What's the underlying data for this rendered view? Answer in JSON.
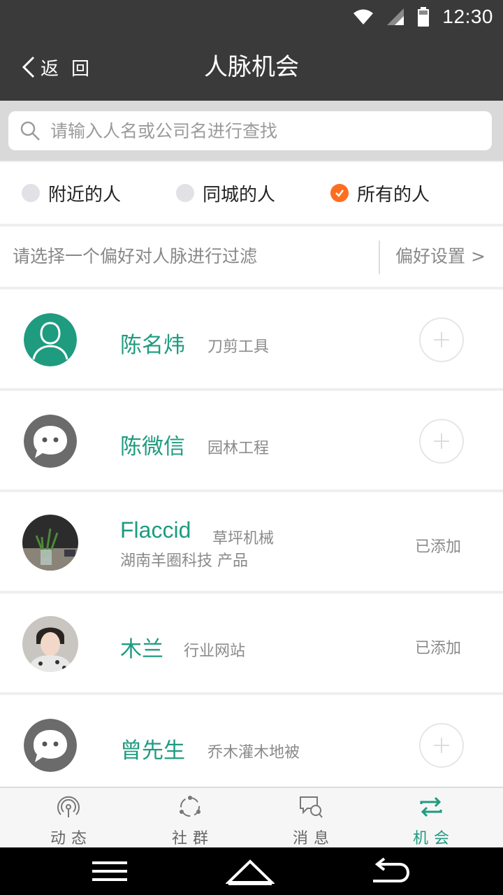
{
  "status_bar": {
    "time": "12:30"
  },
  "header": {
    "back_label": "返回",
    "title": "人脉机会"
  },
  "search": {
    "placeholder": "请输入人名或公司名进行查找"
  },
  "filters": [
    {
      "label": "附近的人",
      "checked": false
    },
    {
      "label": "同城的人",
      "checked": false
    },
    {
      "label": "所有的人",
      "checked": true
    }
  ],
  "preference": {
    "hint": "请选择一个偏好对人脉进行过滤",
    "settings_label": "偏好设置 >"
  },
  "contacts": [
    {
      "name": "陈名炜",
      "industry": "刀剪工具",
      "company": "",
      "status": "add",
      "avatar": "person-silhouette"
    },
    {
      "name": "陈微信",
      "industry": "园林工程",
      "company": "",
      "status": "add",
      "avatar": "chat-bubble"
    },
    {
      "name": "Flaccid",
      "industry": "草坪机械",
      "company": "湖南羊圈科技 产品",
      "status": "已添加",
      "avatar": "photo-plant"
    },
    {
      "name": "木兰",
      "industry": "行业网站",
      "company": "",
      "status": "已添加",
      "avatar": "photo-person"
    },
    {
      "name": "曾先生",
      "industry": "乔木灌木地被",
      "company": "",
      "status": "add",
      "avatar": "chat-bubble"
    }
  ],
  "tabs": [
    {
      "label": "动态",
      "icon": "broadcast-icon",
      "active": false
    },
    {
      "label": "社群",
      "icon": "community-icon",
      "active": false
    },
    {
      "label": "消息",
      "icon": "message-icon",
      "active": false
    },
    {
      "label": "机会",
      "icon": "exchange-icon",
      "active": true
    }
  ],
  "colors": {
    "accent": "#1f9b80",
    "header": "#3a3a3a",
    "checked": "#ff6d1f"
  }
}
